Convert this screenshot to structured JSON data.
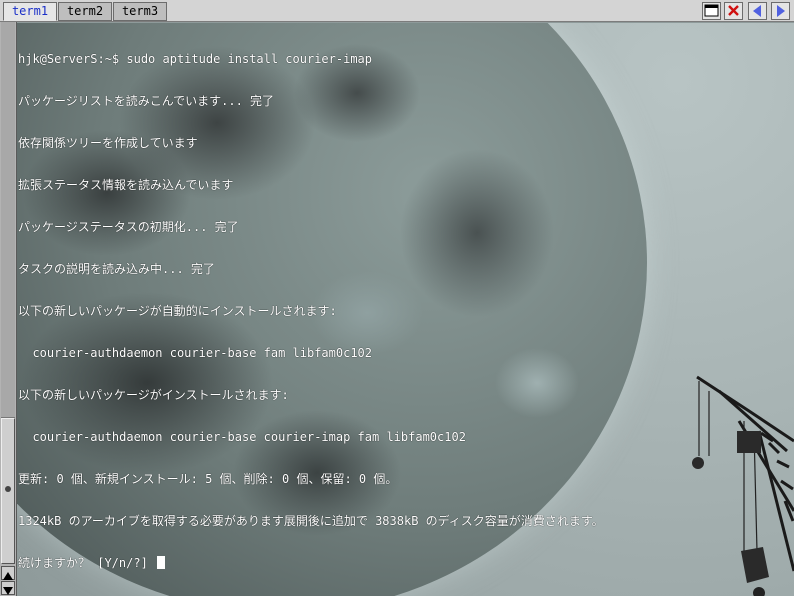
{
  "tabs": [
    {
      "label": "term1",
      "active": true
    },
    {
      "label": "term2",
      "active": false
    },
    {
      "label": "term3",
      "active": false
    }
  ],
  "toolbar_icons": [
    "new-window-icon",
    "close-icon",
    "prev-tab-icon",
    "next-tab-icon"
  ],
  "colors": {
    "accent": "#1a2fc8",
    "close": "#d01010",
    "text": "#ffffff"
  },
  "terminal": {
    "lines": [
      "hjk@ServerS:~$ sudo aptitude install courier-imap",
      "パッケージリストを読みこんでいます... 完了",
      "依存関係ツリーを作成しています",
      "拡張ステータス情報を読み込んでいます",
      "パッケージステータスの初期化... 完了",
      "タスクの説明を読み込み中... 完了",
      "以下の新しいパッケージが自動的にインストールされます:",
      "  courier-authdaemon courier-base fam libfam0c102",
      "以下の新しいパッケージがインストールされます:",
      "  courier-authdaemon courier-base courier-imap fam libfam0c102",
      "更新: 0 個、新規インストール: 5 個、削除: 0 個、保留: 0 個。",
      "1324kB のアーカイブを取得する必要があります展開後に追加で 3838kB のディスク容量が消費されます。",
      "続けますか？ [Y/n/?] "
    ]
  }
}
